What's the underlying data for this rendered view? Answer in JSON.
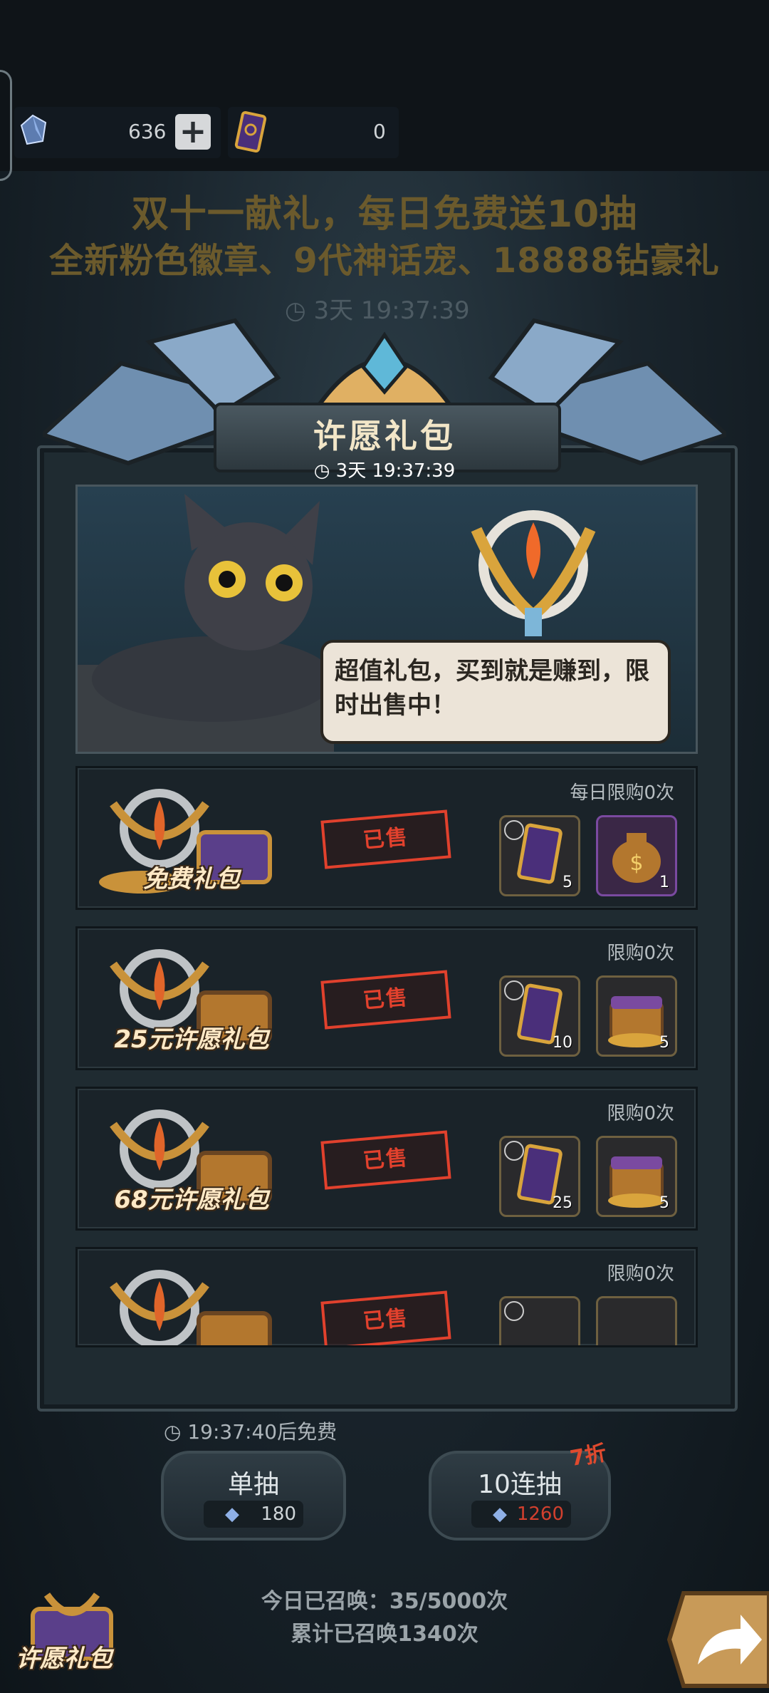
{
  "resources": {
    "gem_value": "636",
    "ticket_value": "0"
  },
  "banner": {
    "line1": "双十一献礼，每日免费送10抽",
    "line2": "全新粉色徽章、9代神话宠、18888钻豪礼"
  },
  "bg_timer": "3天 19:37:39",
  "popup": {
    "title": "许愿礼包",
    "timer": "3天 19:37:39",
    "speech": "超值礼包，买到就是赚到，限时出售中！",
    "rows": [
      {
        "limit": "每日限购0次",
        "label": "免费礼包",
        "status": "已售",
        "item1_count": "5",
        "item2_count": "1"
      },
      {
        "limit": "限购0次",
        "label": "25元许愿礼包",
        "status": "已售",
        "item1_count": "10",
        "item2_count": "5"
      },
      {
        "limit": "限购0次",
        "label": "68元许愿礼包",
        "status": "已售",
        "item1_count": "25",
        "item2_count": "5"
      },
      {
        "limit": "限购0次",
        "label": "",
        "status": "已售",
        "item1_count": "",
        "item2_count": ""
      }
    ]
  },
  "footer": {
    "free_timer": "19:37:40后免费",
    "single": {
      "label": "单抽",
      "cost": "180"
    },
    "ten": {
      "label": "10连抽",
      "cost": "1260",
      "discount": "7折"
    },
    "today_summon": "今日已召唤：35/5000次",
    "total_summon": "累计已召唤1340次",
    "corner_label": "许愿礼包"
  },
  "colors": {
    "accent_red": "#e1412d",
    "banner_gold": "#6b5a2c",
    "title_cream": "#f2e6c8"
  }
}
